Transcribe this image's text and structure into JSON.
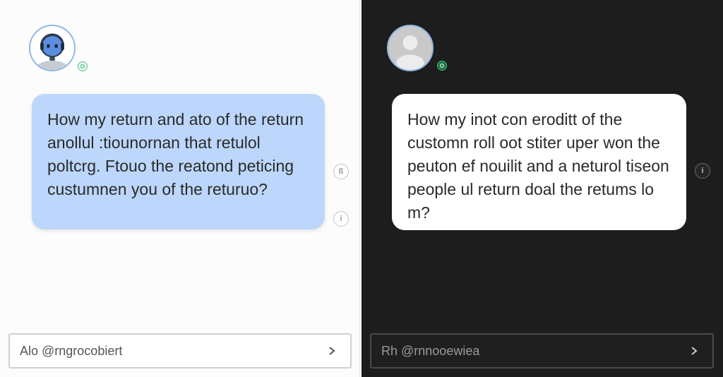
{
  "left": {
    "message": "How my return and ato of the return anollul :tiounornan that retulol poltcrg. Ftouo the reatond peticing custumnen you of the returuo?",
    "side_icons": [
      "ß",
      "i"
    ],
    "input": {
      "placeholder": "Alo @rngrocobiert"
    }
  },
  "right": {
    "message": "How my inot con eroditt of the customn roll oot stiter uper won the peuton ef nouilit and a neturol tiseon people ul return doal the retums lo m?",
    "side_icons": [
      "i"
    ],
    "input": {
      "placeholder": "Rh @rnnooewiea"
    }
  },
  "colors": {
    "left_bubble": "#bcd7fb",
    "right_bubble": "#ffffff",
    "dark_bg": "#1d1d1d",
    "status_green": "#3bbf7d"
  }
}
